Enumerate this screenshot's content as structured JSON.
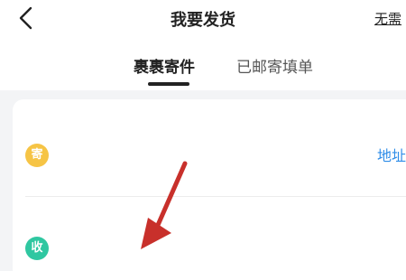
{
  "header": {
    "title": "我要发货",
    "right_link": "无需"
  },
  "tabs": [
    {
      "label": "裹裹寄件",
      "active": true
    },
    {
      "label": "已邮寄填单",
      "active": false
    }
  ],
  "form": {
    "sender_badge": "寄",
    "receiver_badge": "收",
    "address_link": "地址"
  },
  "colors": {
    "sender_badge": "#f6c445",
    "receiver_badge": "#2fc7a1",
    "link": "#2f8de8",
    "arrow": "#c8302b"
  }
}
